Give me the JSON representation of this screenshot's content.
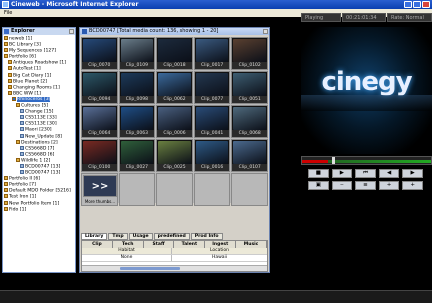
{
  "window": {
    "title": "Cineweb - Microsoft Internet Explorer"
  },
  "menu": {
    "file": "File"
  },
  "explorer": {
    "title": "Explorer",
    "items": [
      {
        "label": "neweb [1]"
      },
      {
        "label": "BC Library [3]"
      },
      {
        "label": "My Sequences [127]"
      },
      {
        "label": "Portfolio [6]"
      },
      {
        "label": "Antiques Roadshow [1]"
      },
      {
        "label": "AutoTest [1]"
      },
      {
        "label": "Big Cat Diary [1]"
      },
      {
        "label": "Blue Planet [2]"
      },
      {
        "label": "Changing Rooms [1]"
      },
      {
        "label": "BBC WW [1]"
      },
      {
        "label": "Rhinoceros [3]"
      },
      {
        "label": "Cultures [5]"
      },
      {
        "label": "Change [15]"
      },
      {
        "label": "CS5113E [33]"
      },
      {
        "label": "CS5113E [30]"
      },
      {
        "label": "Maori [230]"
      },
      {
        "label": "New_Update [8]"
      },
      {
        "label": "Destinations [2]"
      },
      {
        "label": "CS5668D [7]"
      },
      {
        "label": "CS5668D [6]"
      },
      {
        "label": "Wildlife 1 [2]"
      },
      {
        "label": "BCD00747 [13]"
      },
      {
        "label": "BCD00747 [13]"
      },
      {
        "label": "Portfolio II [6]"
      },
      {
        "label": "Portfolio [7]"
      },
      {
        "label": "Default MDO Folder [5216]"
      },
      {
        "label": "Test Iron [1]"
      },
      {
        "label": "New Portfolio Item [1]"
      },
      {
        "label": "Fido [1]"
      }
    ]
  },
  "browser": {
    "title": "BCD00747 [Total media count: 136, showing 1 - 20]",
    "clips": [
      {
        "label": "Clip_0070",
        "color": "#264a7a"
      },
      {
        "label": "Clip_0109",
        "color": "#6a7d8a"
      },
      {
        "label": "Clip_0018",
        "color": "#1c2a3c"
      },
      {
        "label": "Clip_0017",
        "color": "#3a5a80"
      },
      {
        "label": "Clip_0102",
        "color": "#5a4030"
      },
      {
        "label": "Clip_0094",
        "color": "#2d5868"
      },
      {
        "label": "Clip_0098",
        "color": "#1d3a5a"
      },
      {
        "label": "Clip_0062",
        "color": "#3b6a9c"
      },
      {
        "label": "Clip_0077",
        "color": "#243850"
      },
      {
        "label": "Clip_0051",
        "color": "#3e5e72"
      },
      {
        "label": "Clip_0064",
        "color": "#5a7098"
      },
      {
        "label": "Clip_0063",
        "color": "#1f4e86"
      },
      {
        "label": "Clip_0006",
        "color": "#4a6080"
      },
      {
        "label": "Clip_0041",
        "color": "#2a4c78"
      },
      {
        "label": "Clip_0068",
        "color": "#4f6a7d"
      },
      {
        "label": "Clip_0100",
        "color": "#7a2a22"
      },
      {
        "label": "Clip_0027",
        "color": "#2f5f3a"
      },
      {
        "label": "Clip_0025",
        "color": "#6a8040"
      },
      {
        "label": "Clip_0016",
        "color": "#2e5a86"
      },
      {
        "label": "Clip_0107",
        "color": "#4b6a8e"
      }
    ],
    "more": {
      "icon": ">>",
      "label": "More thumbs..."
    },
    "tabs": [
      "Library",
      "Tmp",
      "Usage",
      "predefined",
      "Prod Info"
    ],
    "subtabs": [
      "Clip",
      "Tech Details",
      "Staff",
      "Talent",
      "Ingest",
      "Music"
    ],
    "table": {
      "headers": [
        "Habitat",
        "Location"
      ],
      "row": [
        "None",
        "Hawaii"
      ]
    }
  },
  "player": {
    "status": [
      "Playing",
      "00:21:01:34",
      "Rate: Normal"
    ],
    "logo": "cinegy",
    "controls_row1": [
      "■",
      "▶",
      "⏮",
      "◀",
      "▶"
    ],
    "controls_row2": [
      "▣",
      "‒",
      "≡",
      "+",
      "+"
    ]
  }
}
